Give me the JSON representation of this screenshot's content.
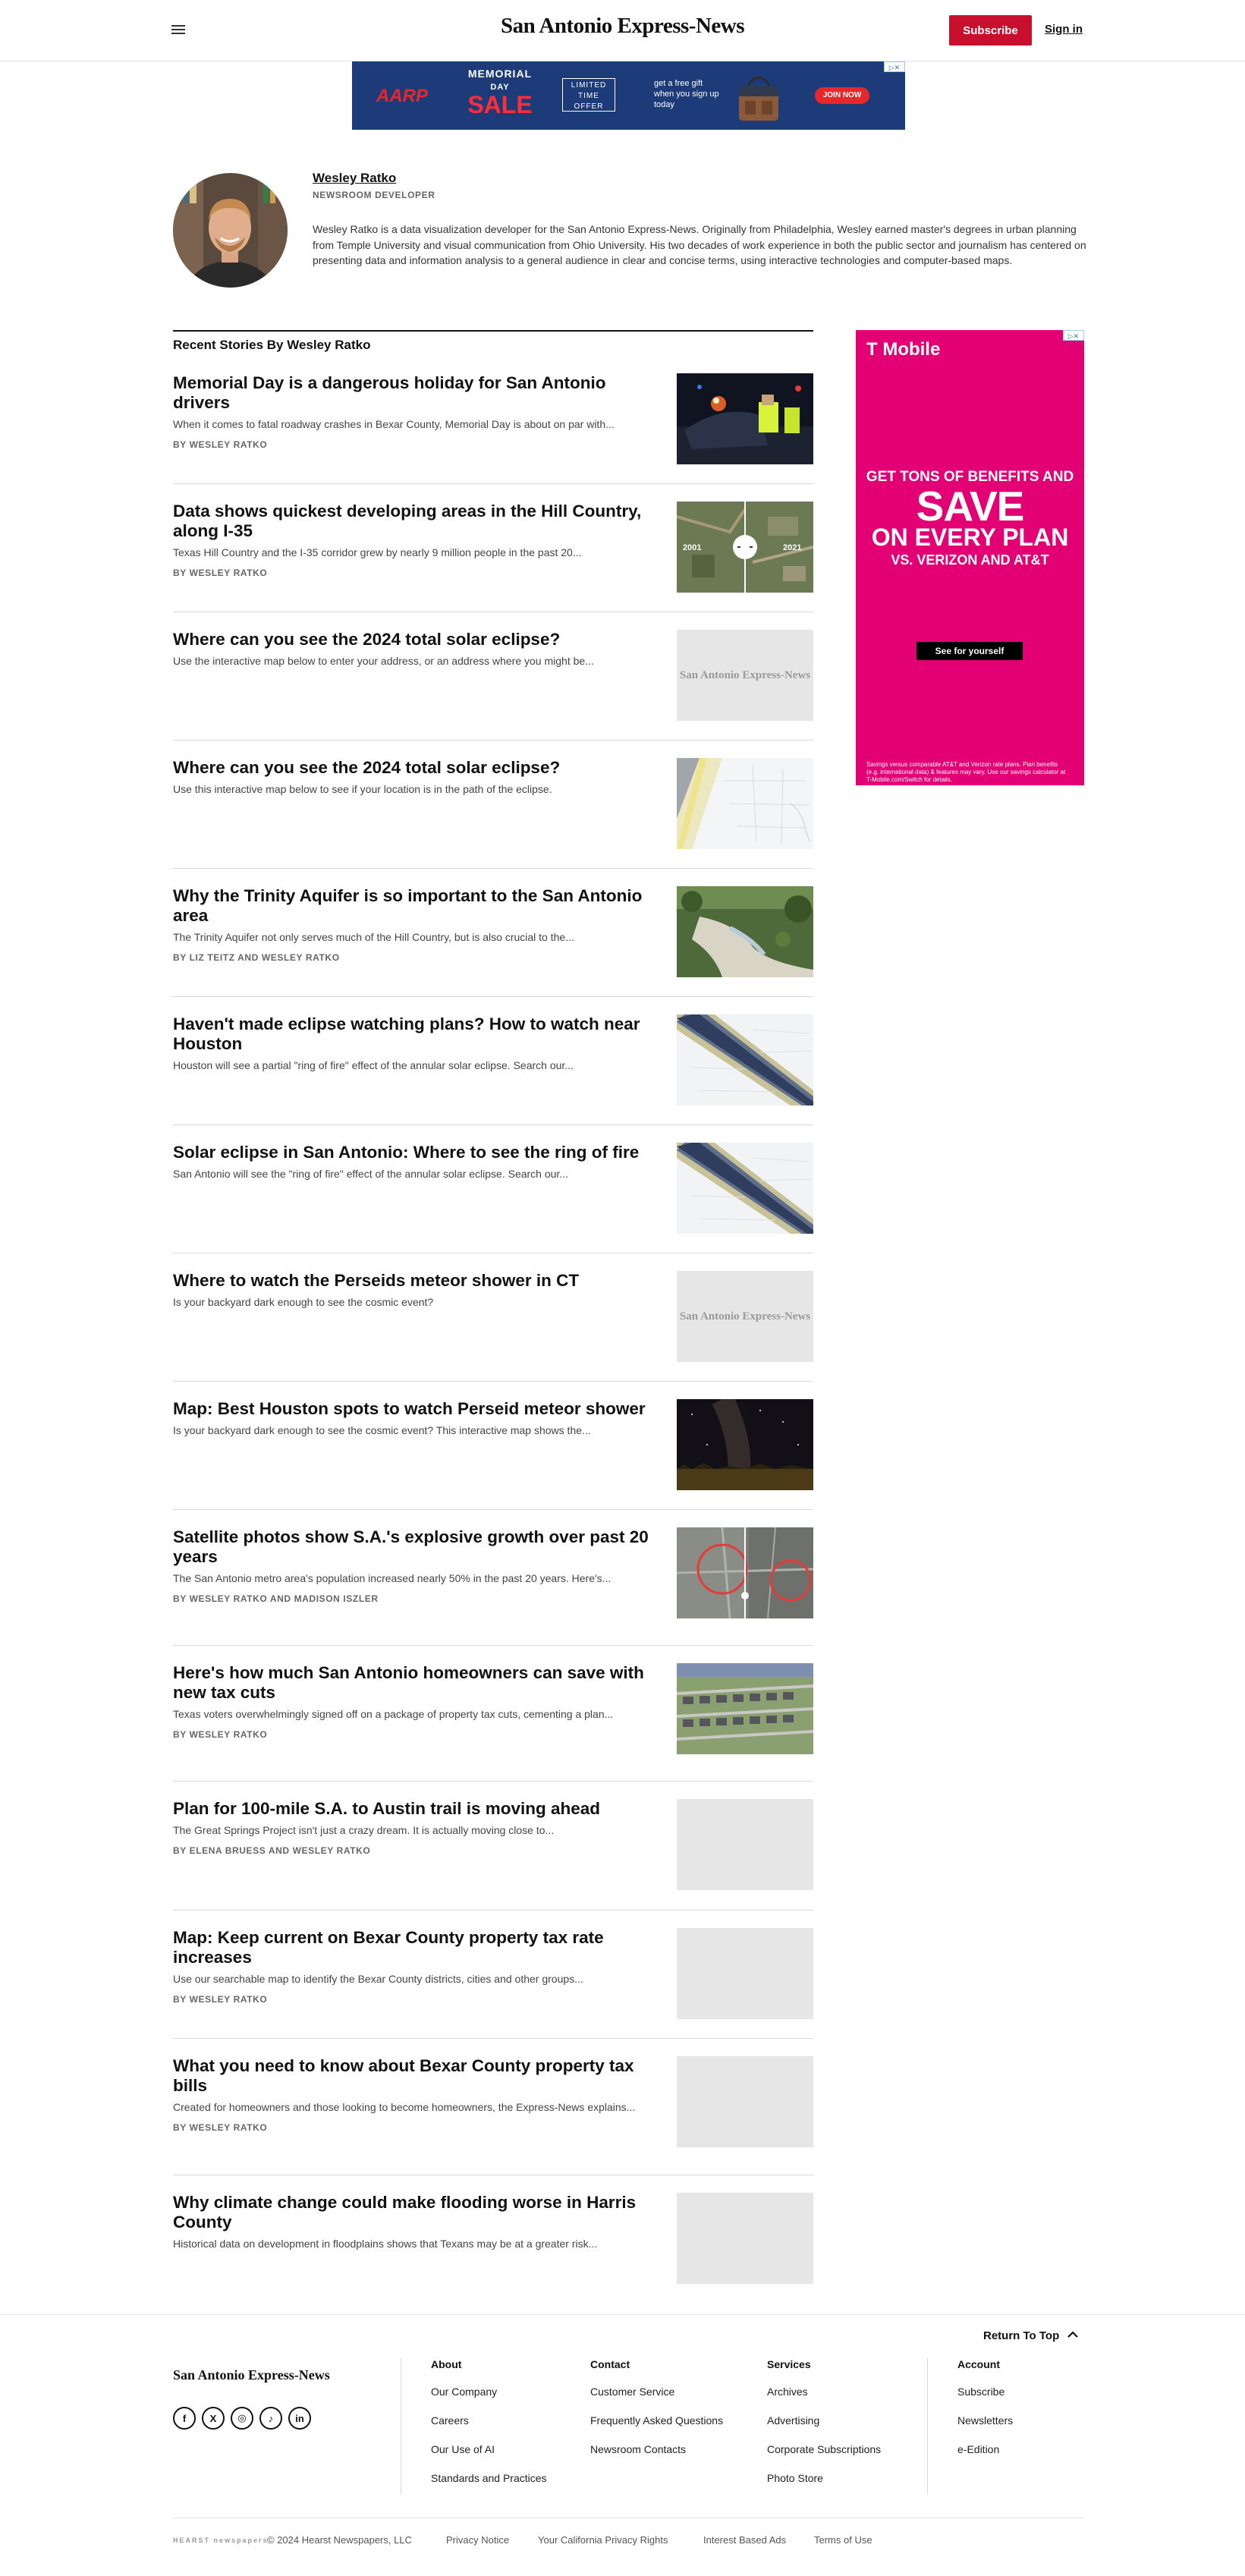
{
  "header": {
    "masthead": "San Antonio Express-News",
    "subscribe_label": "Subscribe",
    "signin_label": "Sign in",
    "accent_color": "#c8102e"
  },
  "top_ad": {
    "brand": "AARP",
    "line1": "MEMORIAL",
    "line2": "DAY",
    "line3": "SALE",
    "offer": "LIMITED TIME OFFER",
    "gift": "get a free gift when you sign up today",
    "cta": "JOIN NOW"
  },
  "author": {
    "name": "Wesley Ratko",
    "role": "NEWSROOM DEVELOPER",
    "bio": "Wesley Ratko is a data visualization developer for the San Antonio Express-News. Originally from Philadelphia, Wesley earned master's degrees in urban planning from Temple University and visual communication from Ohio University. His two decades of work experience in both the public sector and journalism has centered on presenting data and information analysis to a general audience in clear and concise terms, using interactive technologies and computer-based maps."
  },
  "stories_heading": "Recent Stories By Wesley Ratko",
  "stories": [
    {
      "title": "Memorial Day is a dangerous holiday for San Antonio drivers",
      "summary": "When it comes to fatal roadway crashes in Bexar County, Memorial Day is about on par with...",
      "byline": "BY WESLEY RATKO",
      "thumb": "crash"
    },
    {
      "title": "Data shows quickest developing areas in the Hill Country, along I-35",
      "summary": "Texas Hill Country and the I-35 corridor grew by nearly 9 million people in the past 20...",
      "byline": "BY WESLEY RATKO",
      "thumb": "compare"
    },
    {
      "title": "Where can you see the 2024 total solar eclipse?",
      "summary": "Use the interactive map below to enter your address, or an address where you might be...",
      "byline": "",
      "thumb": "logo"
    },
    {
      "title": "Where can you see the 2024 total solar eclipse?",
      "summary": "Use this interactive map below to see if your location is in the path of the eclipse.",
      "byline": "",
      "thumb": "eclipse-map"
    },
    {
      "title": "Why the Trinity Aquifer is so important to the San Antonio area",
      "summary": "The Trinity Aquifer not only serves much of the Hill Country, but is also crucial to the...",
      "byline": "BY LIZ TEITZ AND WESLEY RATKO",
      "thumb": "aquifer"
    },
    {
      "title": "Haven't made eclipse watching plans? How to watch near Houston",
      "summary": "Houston will see a partial \"ring of fire\" effect of the annular solar eclipse. Search our...",
      "byline": "",
      "thumb": "eclipse-band"
    },
    {
      "title": "Solar eclipse in San Antonio: Where to see the ring of fire",
      "summary": "San Antonio will see the \"ring of fire\" effect of the annular solar eclipse. Search our...",
      "byline": "",
      "thumb": "eclipse-band"
    },
    {
      "title": "Where to watch the Perseids meteor shower in CT",
      "summary": "Is your backyard dark enough to see the cosmic event?",
      "byline": "",
      "thumb": "logo"
    },
    {
      "title": "Map: Best Houston spots to watch Perseid meteor shower",
      "summary": "Is your backyard dark enough to see the cosmic event? This interactive map shows the...",
      "byline": "",
      "thumb": "night-sky"
    },
    {
      "title": "Satellite photos show S.A.'s explosive growth over past 20 years",
      "summary": "The San Antonio metro area's population increased nearly 50% in the past 20 years. Here's...",
      "byline": "BY WESLEY RATKO AND MADISON ISZLER",
      "thumb": "satellite"
    },
    {
      "title": "Here's how much San Antonio homeowners can save with new tax cuts",
      "summary": "Texas voters overwhelmingly signed off on a package of property tax cuts, cementing a plan...",
      "byline": "BY WESLEY RATKO",
      "thumb": "houses"
    },
    {
      "title": "Plan for 100-mile S.A. to Austin trail is moving ahead",
      "summary": "The Great Springs Project isn't just a crazy dream. It is actually moving close to...",
      "byline": "BY ELENA BRUESS AND WESLEY RATKO",
      "thumb": "blank"
    },
    {
      "title": "Map: Keep current on Bexar County property tax rate increases",
      "summary": "Use our searchable map to identify the Bexar County districts, cities and other groups...",
      "byline": "BY WESLEY RATKO",
      "thumb": "blank"
    },
    {
      "title": "What you need to know about Bexar County property tax bills",
      "summary": "Created for homeowners and those looking to become homeowners, the Express-News explains...",
      "byline": "BY WESLEY RATKO",
      "thumb": "blank"
    },
    {
      "title": "Why climate change could make flooding worse in Harris County",
      "summary": "Historical data on development in floodplains shows that Texans may be at a greater risk...",
      "byline": "",
      "thumb": "blank"
    }
  ],
  "thumb_logo_text": "San Antonio Express-News",
  "compare_labels": {
    "left": "2001",
    "right": "2021"
  },
  "side_ad": {
    "brand": "T Mobile",
    "line1": "GET TONS OF BENEFITS AND",
    "line2": "SAVE",
    "line3": "ON EVERY PLAN",
    "line4": "VS. VERIZON AND AT&T",
    "cta": "See for yourself",
    "fine_print": "Savings versus comparable AT&T and Verizon rate plans. Plan benefits (e.g. international data) & features may vary. Use our savings calculator at T-Mobile.com/Switch for details.",
    "color": "#e20074"
  },
  "footer": {
    "return_top": "Return To Top",
    "logo": "San Antonio Express-News",
    "social": [
      "facebook-icon",
      "x-icon",
      "instagram-icon",
      "tiktok-icon",
      "linkedin-icon"
    ],
    "columns": [
      {
        "title": "About",
        "links": [
          "Our Company",
          "Careers",
          "Our Use of AI",
          "Standards and Practices"
        ]
      },
      {
        "title": "Contact",
        "links": [
          "Customer Service",
          "Frequently Asked Questions",
          "Newsroom Contacts"
        ]
      },
      {
        "title": "Services",
        "links": [
          "Archives",
          "Advertising",
          "Corporate Subscriptions",
          "Photo Store"
        ]
      },
      {
        "title": "Account",
        "links": [
          "Subscribe",
          "Newsletters",
          "e-Edition"
        ]
      }
    ],
    "hearst": "HEARST newspapers",
    "copyright": "© 2024 Hearst Newspapers, LLC",
    "legal_links": [
      "Privacy Notice",
      "Your California Privacy Rights",
      "Interest Based Ads",
      "Terms of Use"
    ]
  }
}
